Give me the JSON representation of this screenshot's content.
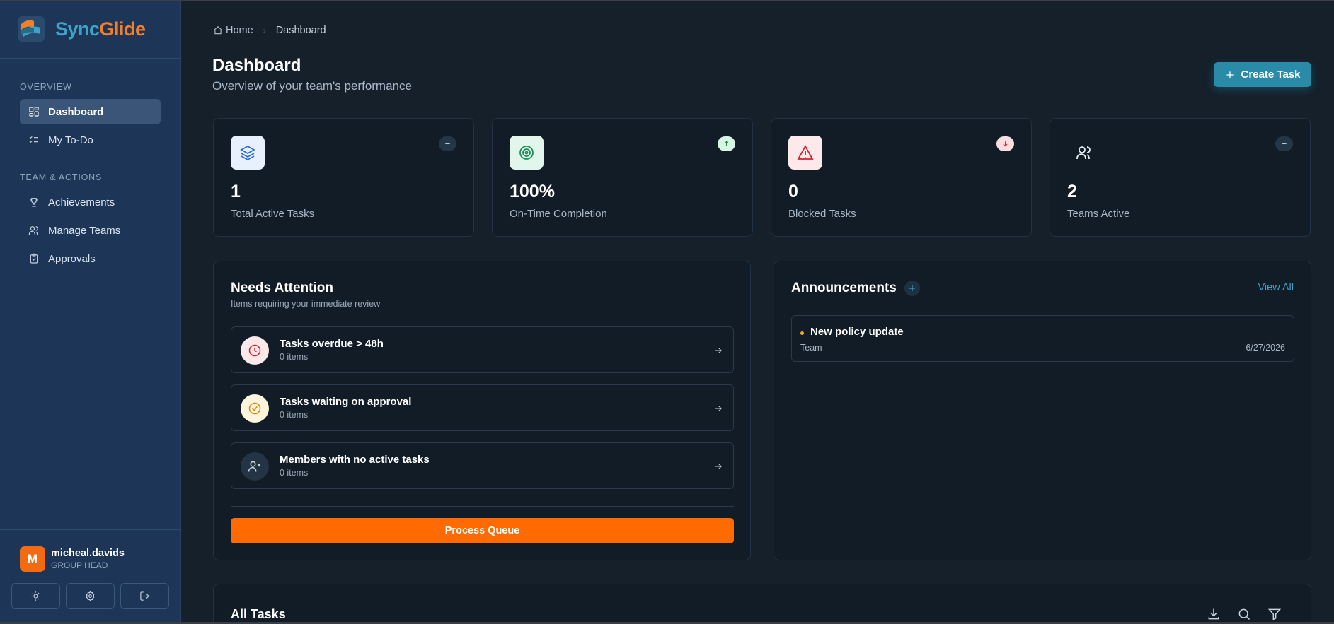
{
  "brand": {
    "sync": "Sync",
    "glide": "Glide"
  },
  "sidebar": {
    "section_overview": "OVERVIEW",
    "section_team": "TEAM & ACTIONS",
    "items": [
      {
        "label": "Dashboard",
        "icon": "grid-icon",
        "active": true
      },
      {
        "label": "My To-Do",
        "icon": "checklist-icon",
        "active": false
      },
      {
        "label": "Achievements",
        "icon": "trophy-icon",
        "active": false
      },
      {
        "label": "Manage Teams",
        "icon": "users-icon",
        "active": false
      },
      {
        "label": "Approvals",
        "icon": "clipboard-check-icon",
        "active": false
      }
    ],
    "user": {
      "initial": "M",
      "name": "micheal.davids",
      "role": "GROUP HEAD"
    },
    "actions": [
      "sun-icon",
      "gear-icon",
      "logout-icon"
    ]
  },
  "breadcrumb": {
    "home": "Home",
    "current": "Dashboard"
  },
  "header": {
    "title": "Dashboard",
    "subtitle": "Overview of your team's performance",
    "create_label": "Create Task"
  },
  "stats": [
    {
      "value": "1",
      "label": "Total Active Tasks",
      "icon": "layers-icon",
      "trend": "neutral"
    },
    {
      "value": "100%",
      "label": "On-Time Completion",
      "icon": "target-icon",
      "trend": "up"
    },
    {
      "value": "0",
      "label": "Blocked Tasks",
      "icon": "alert-triangle-icon",
      "trend": "down"
    },
    {
      "value": "2",
      "label": "Teams Active",
      "icon": "users-icon",
      "trend": "neutral"
    }
  ],
  "attention": {
    "title": "Needs Attention",
    "subtitle": "Items requiring your immediate review",
    "items": [
      {
        "title": "Tasks overdue > 48h",
        "count": "0 items",
        "icon": "clock-icon"
      },
      {
        "title": "Tasks waiting on approval",
        "count": "0 items",
        "icon": "check-circle-icon"
      },
      {
        "title": "Members with no active tasks",
        "count": "0 items",
        "icon": "user-x-icon"
      }
    ],
    "process_label": "Process Queue"
  },
  "announcements": {
    "title": "Announcements",
    "view_all": "View All",
    "items": [
      {
        "title": "New policy update",
        "audience": "Team",
        "date": "6/27/2026"
      }
    ]
  },
  "tasks": {
    "title": "All Tasks",
    "tools": [
      "download-icon",
      "search-icon",
      "filter-icon"
    ]
  },
  "colors": {
    "accent": "#2a8ba8",
    "orange": "#ff6b00",
    "sidebar": "#1d3556",
    "background": "#15202b"
  }
}
